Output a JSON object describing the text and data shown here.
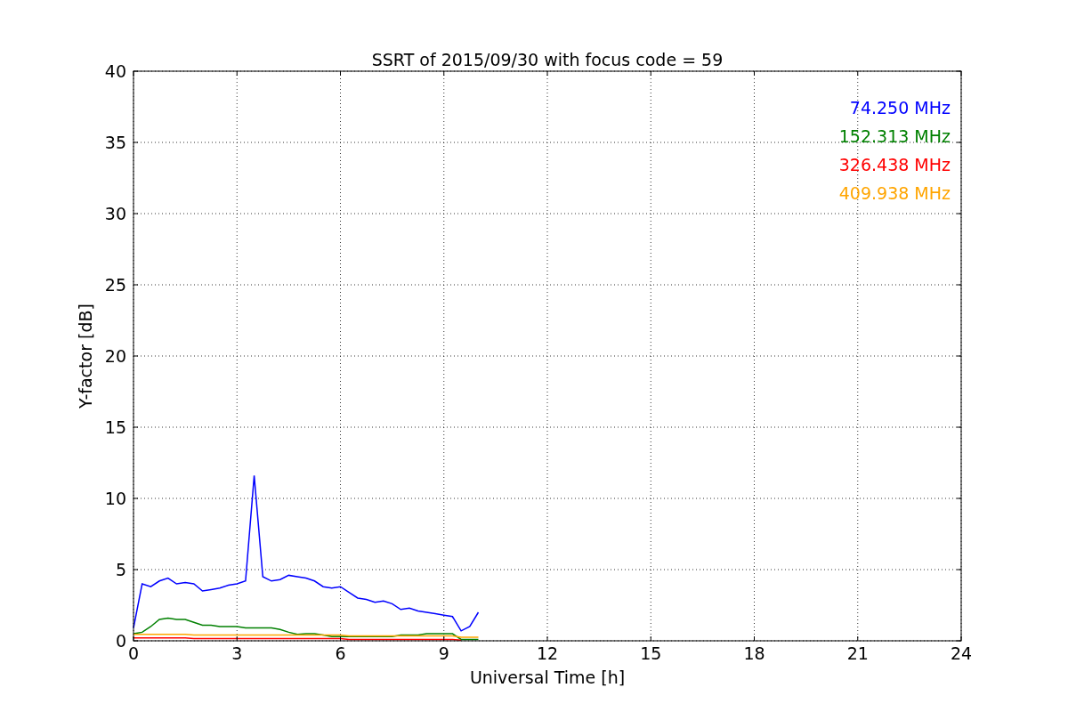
{
  "chart_data": {
    "type": "line",
    "title": "SSRT of 2015/09/30 with focus code = 59",
    "xlabel": "Universal Time [h]",
    "ylabel": "Y-factor [dB]",
    "x": [
      0,
      0.25,
      0.5,
      0.75,
      1,
      1.25,
      1.5,
      1.75,
      2,
      2.25,
      2.5,
      2.75,
      3,
      3.25,
      3.5,
      3.75,
      4,
      4.25,
      4.5,
      4.75,
      5,
      5.25,
      5.5,
      5.75,
      6,
      6.25,
      6.5,
      6.75,
      7,
      7.25,
      7.5,
      7.75,
      8,
      8.25,
      8.5,
      8.75,
      9,
      9.25,
      9.5,
      9.75,
      10
    ],
    "series": [
      {
        "name": "74.250 MHz",
        "color": "#0000ff",
        "values": [
          0.9,
          4.0,
          3.8,
          4.2,
          4.4,
          4.0,
          4.1,
          4.0,
          3.5,
          3.6,
          3.7,
          3.9,
          4.0,
          4.2,
          11.6,
          4.5,
          4.2,
          4.3,
          4.6,
          4.5,
          4.4,
          4.2,
          3.8,
          3.7,
          3.8,
          3.4,
          3.0,
          2.9,
          2.7,
          2.8,
          2.6,
          2.2,
          2.3,
          2.1,
          2.0,
          1.9,
          1.8,
          1.7,
          0.7,
          1.0,
          2.0
        ]
      },
      {
        "name": "152.313 MHz",
        "color": "#008000",
        "values": [
          0.5,
          0.6,
          1.0,
          1.5,
          1.6,
          1.5,
          1.5,
          1.3,
          1.1,
          1.1,
          1.0,
          1.0,
          1.0,
          0.9,
          0.9,
          0.9,
          0.9,
          0.8,
          0.6,
          0.45,
          0.5,
          0.5,
          0.4,
          0.3,
          0.3,
          0.3,
          0.3,
          0.3,
          0.3,
          0.3,
          0.3,
          0.4,
          0.4,
          0.4,
          0.5,
          0.5,
          0.5,
          0.5,
          0.1,
          0.1,
          0.1
        ]
      },
      {
        "name": "326.438 MHz",
        "color": "#ff0000",
        "values": [
          0.2,
          0.2,
          0.2,
          0.2,
          0.2,
          0.2,
          0.2,
          0.15,
          0.15,
          0.15,
          0.15,
          0.15,
          0.15,
          0.15,
          0.15,
          0.15,
          0.15,
          0.15,
          0.15,
          0.15,
          0.15,
          0.15,
          0.15,
          0.15,
          0.15,
          0.1,
          0.1,
          0.1,
          0.1,
          0.1,
          0.1,
          0.1,
          0.1,
          0.1,
          0.1,
          0.1,
          0.1,
          0.1,
          0.05,
          null,
          null
        ]
      },
      {
        "name": "409.938 MHz",
        "color": "#ffa500",
        "values": [
          0.45,
          0.45,
          0.45,
          0.45,
          0.45,
          0.45,
          0.45,
          0.4,
          0.4,
          0.4,
          0.4,
          0.4,
          0.4,
          0.4,
          0.4,
          0.4,
          0.4,
          0.4,
          0.4,
          0.4,
          0.4,
          0.4,
          0.4,
          0.4,
          0.4,
          0.35,
          0.35,
          0.35,
          0.35,
          0.35,
          0.35,
          0.35,
          0.35,
          0.35,
          0.35,
          0.35,
          0.35,
          0.35,
          0.25,
          0.25,
          0.25
        ]
      }
    ],
    "grid": true,
    "xlim": [
      0,
      24
    ],
    "ylim": [
      0,
      40
    ],
    "xticks": [
      0,
      3,
      6,
      9,
      12,
      15,
      18,
      21,
      24
    ],
    "yticks": [
      0,
      5,
      10,
      15,
      20,
      25,
      30,
      35,
      40
    ]
  }
}
